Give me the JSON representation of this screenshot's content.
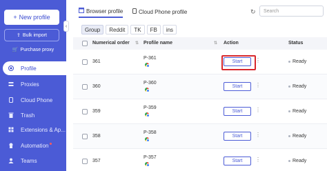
{
  "sidebar": {
    "new_profile": "New profile",
    "bulk_import": "Bulk import",
    "purchase_proxy": "Purchase proxy",
    "items": [
      {
        "label": "Profile",
        "icon": "profile-icon"
      },
      {
        "label": "Proxies",
        "icon": "proxies-icon"
      },
      {
        "label": "Cloud Phone",
        "icon": "cloud-phone-icon"
      },
      {
        "label": "Trash",
        "icon": "trash-icon"
      },
      {
        "label": "Extensions & Ap...",
        "icon": "extensions-icon"
      },
      {
        "label": "Automation",
        "icon": "automation-icon"
      },
      {
        "label": "Teams",
        "icon": "teams-icon"
      }
    ]
  },
  "tabs": {
    "browser_profile": "Browser profile",
    "cloud_phone_profile": "Cloud Phone profile"
  },
  "search": {
    "placeholder": "Search"
  },
  "filters": [
    "Group",
    "Reddit",
    "TK",
    "FB",
    "ins"
  ],
  "table": {
    "headers": {
      "order": "Numerical order",
      "name": "Profile name",
      "action": "Action",
      "status": "Status"
    },
    "rows": [
      {
        "order": "361",
        "name": "P-361",
        "action": "Start",
        "status": "Ready"
      },
      {
        "order": "360",
        "name": "P-360",
        "action": "Start",
        "status": "Ready"
      },
      {
        "order": "359",
        "name": "P-359",
        "action": "Start",
        "status": "Ready"
      },
      {
        "order": "358",
        "name": "P-358",
        "action": "Start",
        "status": "Ready"
      },
      {
        "order": "357",
        "name": "P-357",
        "action": "Start",
        "status": "Ready"
      }
    ]
  },
  "colors": {
    "accent": "#4b5bd6",
    "highlight": "#d7262b"
  }
}
